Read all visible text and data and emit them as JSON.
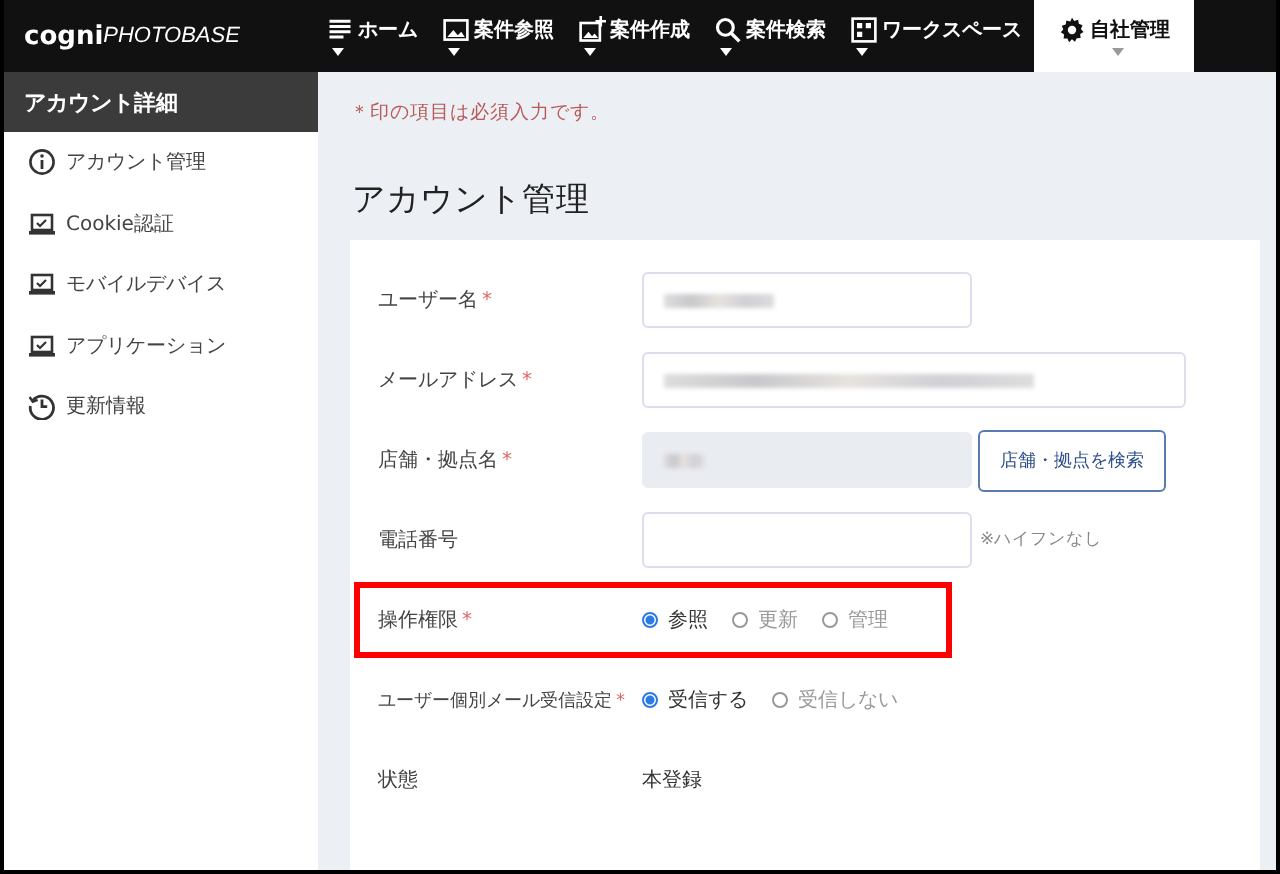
{
  "logo": {
    "brand": "cogni",
    "product": "PHOTOBASE"
  },
  "nav": [
    {
      "label": "ホーム",
      "selected": false
    },
    {
      "label": "案件参照",
      "selected": false
    },
    {
      "label": "案件作成",
      "selected": false
    },
    {
      "label": "案件検索",
      "selected": false
    },
    {
      "label": "ワークスペース",
      "selected": false
    },
    {
      "label": "自社管理",
      "selected": true
    }
  ],
  "sidebar": {
    "title": "アカウント詳細",
    "items": [
      {
        "label": "アカウント管理"
      },
      {
        "label": "Cookie認証"
      },
      {
        "label": "モバイルデバイス"
      },
      {
        "label": "アプリケーション"
      },
      {
        "label": "更新情報"
      }
    ]
  },
  "notice": "＊印の項目は必須入力です。",
  "heading": "アカウント管理",
  "form": [
    {
      "kind": "short-field",
      "label": "ユーザー名",
      "required_mark": "*",
      "redacted": true,
      "highlighted": false
    },
    {
      "kind": "long-field",
      "label": "メールアドレス",
      "required_mark": "*",
      "redacted": true,
      "highlighted": false
    },
    {
      "kind": "picker",
      "label": "店舗・拠点名",
      "required_mark": "*",
      "redacted": true,
      "button": "店舗・拠点を検索",
      "highlighted": false
    },
    {
      "kind": "phone",
      "label": "電話番号",
      "note": "※ハイフンなし",
      "highlighted": false
    },
    {
      "kind": "radio",
      "label": "操作権限",
      "required_mark": "*",
      "highlighted": true,
      "options": [
        {
          "label": "参照",
          "selected": true
        },
        {
          "label": "更新",
          "selected": false
        },
        {
          "label": "管理",
          "selected": false
        }
      ]
    },
    {
      "kind": "radio",
      "label": "ユーザー個別メール受信設定",
      "required_mark": "*",
      "highlighted": false,
      "options": [
        {
          "label": "受信する",
          "selected": true
        },
        {
          "label": "受信しない",
          "selected": false
        }
      ]
    },
    {
      "kind": "static",
      "label": "状態",
      "value": "本登録",
      "highlighted": false
    }
  ]
}
